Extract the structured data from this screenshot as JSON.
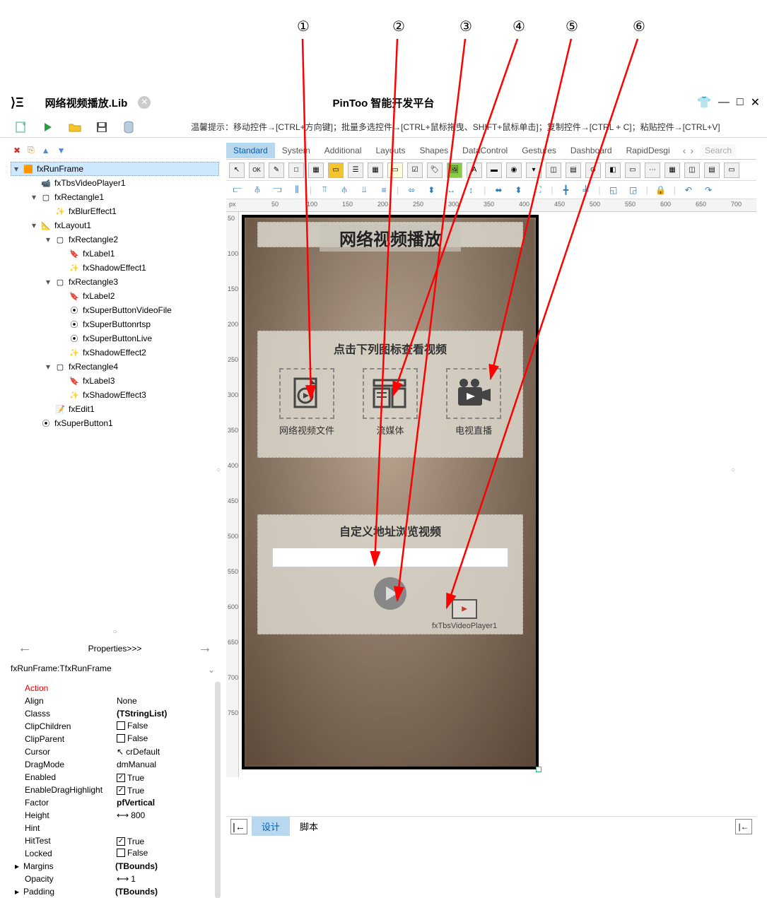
{
  "annotations": [
    "①",
    "②",
    "③",
    "④",
    "⑤",
    "⑥"
  ],
  "titlebar": {
    "lib_name": "网络视频播放.Lib",
    "app_title": "PinToo 智能开发平台",
    "minimize": "—",
    "maximize": "□",
    "close": "✕"
  },
  "hint": "温馨提示：移动控件→[CTRL+方向键]；批量多选控件→[CTRL+鼠标拖曳、SHIFT+鼠标单击]；复制控件→[CTRL + C]；粘贴控件→[CTRL+V]",
  "tabs": {
    "items": [
      "Standard",
      "System",
      "Additional",
      "Layouts",
      "Shapes",
      "DataControl",
      "Gestures",
      "Dashboard",
      "RapidDesgi"
    ],
    "active": 0,
    "search_placeholder": "Search"
  },
  "tree": [
    {
      "level": 0,
      "toggle": "▾",
      "icon": "frame",
      "label": "fxRunFrame",
      "selected": true
    },
    {
      "level": 1,
      "toggle": "",
      "icon": "video",
      "label": "fxTbsVideoPlayer1"
    },
    {
      "level": 1,
      "toggle": "▾",
      "icon": "rect",
      "label": "fxRectangle1"
    },
    {
      "level": 2,
      "toggle": "",
      "icon": "fx",
      "label": "fxBlurEffect1"
    },
    {
      "level": 1,
      "toggle": "▾",
      "icon": "layout",
      "label": "fxLayout1"
    },
    {
      "level": 2,
      "toggle": "▾",
      "icon": "rect",
      "label": "fxRectangle2"
    },
    {
      "level": 3,
      "toggle": "",
      "icon": "label",
      "label": "fxLabel1"
    },
    {
      "level": 3,
      "toggle": "",
      "icon": "fx",
      "label": "fxShadowEffect1"
    },
    {
      "level": 2,
      "toggle": "▾",
      "icon": "rect",
      "label": "fxRectangle3"
    },
    {
      "level": 3,
      "toggle": "",
      "icon": "label",
      "label": "fxLabel2"
    },
    {
      "level": 3,
      "toggle": "",
      "icon": "btn",
      "label": "fxSuperButtonVideoFile"
    },
    {
      "level": 3,
      "toggle": "",
      "icon": "btn",
      "label": "fxSuperButtonrtsp"
    },
    {
      "level": 3,
      "toggle": "",
      "icon": "btn",
      "label": "fxSuperButtonLive"
    },
    {
      "level": 3,
      "toggle": "",
      "icon": "fx",
      "label": "fxShadowEffect2"
    },
    {
      "level": 2,
      "toggle": "▾",
      "icon": "rect",
      "label": "fxRectangle4"
    },
    {
      "level": 3,
      "toggle": "",
      "icon": "label",
      "label": "fxLabel3"
    },
    {
      "level": 3,
      "toggle": "",
      "icon": "fx",
      "label": "fxShadowEffect3"
    },
    {
      "level": 2,
      "toggle": "",
      "icon": "edit",
      "label": "fxEdit1"
    },
    {
      "level": 1,
      "toggle": "",
      "icon": "btn",
      "label": "fxSuperButton1"
    }
  ],
  "properties": {
    "nav_label": "Properties>>>",
    "object_name": "fxRunFrame:TfxRunFrame",
    "rows": [
      {
        "name": "Action",
        "value": "",
        "type": "action"
      },
      {
        "name": "Align",
        "value": "None",
        "type": "text"
      },
      {
        "name": "Classs",
        "value": "(TStringList)",
        "type": "bold"
      },
      {
        "name": "ClipChildren",
        "value": "False",
        "type": "check-off"
      },
      {
        "name": "ClipParent",
        "value": "False",
        "type": "check-off"
      },
      {
        "name": "Cursor",
        "value": "crDefault",
        "type": "cursor"
      },
      {
        "name": "DragMode",
        "value": "dmManual",
        "type": "text"
      },
      {
        "name": "Enabled",
        "value": "True",
        "type": "check-on"
      },
      {
        "name": "EnableDragHighlight",
        "value": "True",
        "type": "check-on"
      },
      {
        "name": "Factor",
        "value": "pfVertical",
        "type": "bold"
      },
      {
        "name": "Height",
        "value": "800",
        "type": "size"
      },
      {
        "name": "Hint",
        "value": "",
        "type": "text"
      },
      {
        "name": "HitTest",
        "value": "True",
        "type": "check-on"
      },
      {
        "name": "Locked",
        "value": "False",
        "type": "check-off"
      },
      {
        "name": "Margins",
        "value": "(TBounds)",
        "type": "bold-expand"
      },
      {
        "name": "Opacity",
        "value": "1",
        "type": "size"
      },
      {
        "name": "Padding",
        "value": "(TBounds)",
        "type": "bold-expand"
      }
    ]
  },
  "canvas": {
    "title": "网络视频播放",
    "section2_title": "点击下列图标查看视频",
    "icons": [
      {
        "label": "网络视频文件"
      },
      {
        "label": "流媒体"
      },
      {
        "label": "电视直播"
      }
    ],
    "section3_title": "自定义地址浏览视频",
    "video_player_label": "fxTbsVideoPlayer1"
  },
  "ruler_h": [
    "px",
    "50",
    "100",
    "150",
    "200",
    "250",
    "300",
    "350",
    "400",
    "450",
    "500",
    "550",
    "600",
    "650",
    "700"
  ],
  "ruler_v": [
    "50",
    "100",
    "150",
    "200",
    "250",
    "300",
    "350",
    "400",
    "450",
    "500",
    "550",
    "600",
    "650",
    "700",
    "750"
  ],
  "bottom": {
    "tab_design": "设计",
    "tab_script": "脚本"
  }
}
